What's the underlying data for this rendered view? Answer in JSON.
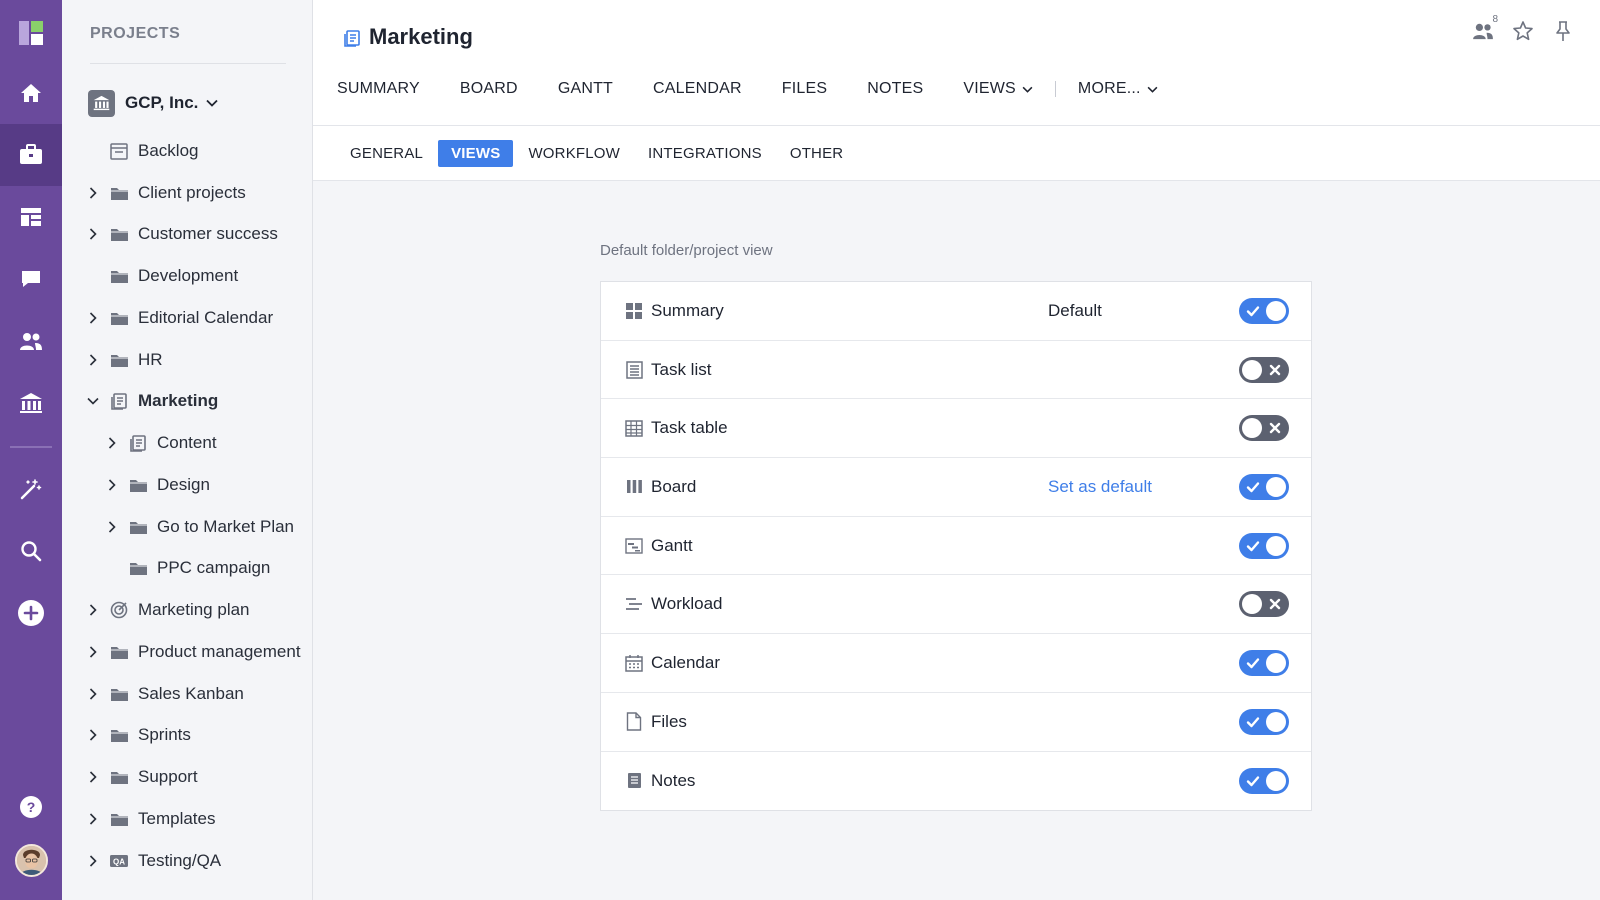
{
  "rail": {
    "items": [
      {
        "name": "home-icon"
      },
      {
        "name": "projects-briefcase-icon"
      },
      {
        "name": "dashboard-icon"
      },
      {
        "name": "chat-icon"
      },
      {
        "name": "team-icon"
      },
      {
        "name": "organization-icon"
      },
      {
        "name": "magic-wand-icon"
      },
      {
        "name": "search-icon"
      },
      {
        "name": "add-icon"
      },
      {
        "name": "help-icon"
      }
    ]
  },
  "sidebar": {
    "title": "PROJECTS",
    "org_name": "GCP, Inc.",
    "items": [
      {
        "label": "Backlog",
        "level": 0,
        "expander": "none",
        "icon": "backlog-icon"
      },
      {
        "label": "Client projects",
        "level": 0,
        "expander": "collapsed",
        "icon": "folder-icon"
      },
      {
        "label": "Customer success",
        "level": 0,
        "expander": "collapsed",
        "icon": "folder-icon"
      },
      {
        "label": "Development",
        "level": 0,
        "expander": "none",
        "icon": "folder-icon"
      },
      {
        "label": "Editorial Calendar",
        "level": 0,
        "expander": "collapsed",
        "icon": "folder-icon"
      },
      {
        "label": "HR",
        "level": 0,
        "expander": "collapsed",
        "icon": "folder-icon"
      },
      {
        "label": "Marketing",
        "level": 0,
        "expander": "expanded",
        "icon": "project-icon",
        "selected": true
      },
      {
        "label": "Content",
        "level": 1,
        "expander": "collapsed",
        "icon": "project-icon"
      },
      {
        "label": "Design",
        "level": 1,
        "expander": "collapsed",
        "icon": "folder-icon"
      },
      {
        "label": "Go to Market Plan",
        "level": 1,
        "expander": "collapsed",
        "icon": "folder-icon"
      },
      {
        "label": "PPC campaign",
        "level": 1,
        "expander": "none",
        "icon": "folder-icon"
      },
      {
        "label": "Marketing plan",
        "level": 0,
        "expander": "collapsed",
        "icon": "target-icon"
      },
      {
        "label": "Product management",
        "level": 0,
        "expander": "collapsed",
        "icon": "folder-icon"
      },
      {
        "label": "Sales Kanban",
        "level": 0,
        "expander": "collapsed",
        "icon": "folder-icon"
      },
      {
        "label": "Sprints",
        "level": 0,
        "expander": "collapsed",
        "icon": "folder-icon"
      },
      {
        "label": "Support",
        "level": 0,
        "expander": "collapsed",
        "icon": "folder-icon"
      },
      {
        "label": "Templates",
        "level": 0,
        "expander": "collapsed",
        "icon": "folder-icon"
      },
      {
        "label": "Testing/QA",
        "level": 0,
        "expander": "collapsed",
        "icon": "qa-icon"
      }
    ]
  },
  "header": {
    "title": "Marketing",
    "members_count": "8",
    "tabs": [
      "SUMMARY",
      "BOARD",
      "GANTT",
      "CALENDAR",
      "FILES",
      "NOTES",
      "VIEWS"
    ],
    "more_label": "MORE..."
  },
  "settings_tabs": {
    "items": [
      "GENERAL",
      "VIEWS",
      "WORKFLOW",
      "INTEGRATIONS",
      "OTHER"
    ],
    "active": "VIEWS"
  },
  "views_settings": {
    "section_label": "Default folder/project view",
    "rows": [
      {
        "name": "Summary",
        "icon": "summary-grid-icon",
        "status": "Default",
        "enabled": true
      },
      {
        "name": "Task list",
        "icon": "task-list-icon",
        "status": "",
        "enabled": false
      },
      {
        "name": "Task table",
        "icon": "task-table-icon",
        "status": "",
        "enabled": false
      },
      {
        "name": "Board",
        "icon": "board-columns-icon",
        "status": "Set as default",
        "enabled": true
      },
      {
        "name": "Gantt",
        "icon": "gantt-icon",
        "status": "",
        "enabled": true
      },
      {
        "name": "Workload",
        "icon": "workload-icon",
        "status": "",
        "enabled": false
      },
      {
        "name": "Calendar",
        "icon": "calendar-icon",
        "status": "",
        "enabled": true
      },
      {
        "name": "Files",
        "icon": "file-icon",
        "status": "",
        "enabled": true
      },
      {
        "name": "Notes",
        "icon": "notes-icon",
        "status": "",
        "enabled": true
      }
    ]
  },
  "colors": {
    "rail": "#6a4a9c",
    "accent": "#3f7ee8",
    "toggle_off": "#5c6170"
  }
}
